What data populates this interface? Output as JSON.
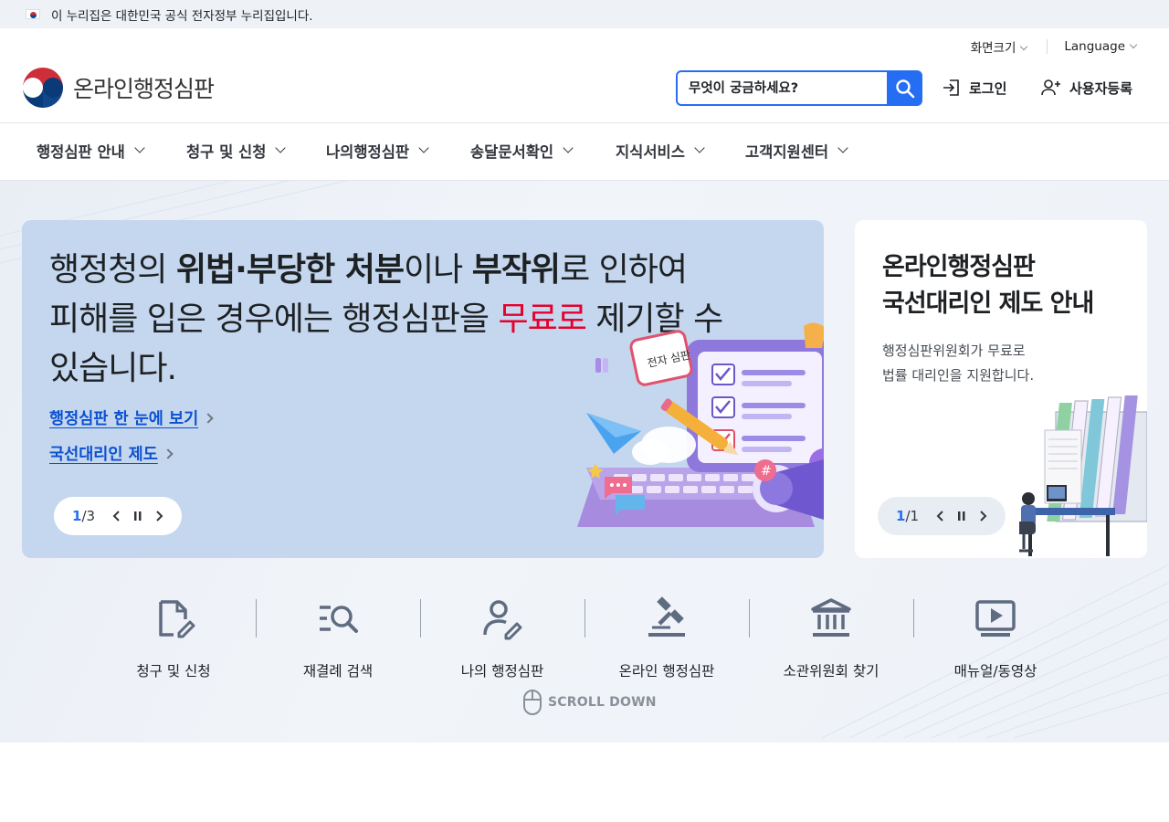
{
  "gov_banner": {
    "text": "이 누리집은 대한민국 공식 전자정부 누리집입니다."
  },
  "utility": {
    "font_size": "화면크기",
    "language": "Language"
  },
  "logo": {
    "text": "온라인행정심판"
  },
  "search": {
    "placeholder": "무엇이 궁금하세요?"
  },
  "header_buttons": {
    "login": "로그인",
    "register": "사용자등록"
  },
  "nav": [
    {
      "label": "행정심판 안내"
    },
    {
      "label": "청구 및 신청"
    },
    {
      "label": "나의행정심판"
    },
    {
      "label": "송달문서확인"
    },
    {
      "label": "지식서비스"
    },
    {
      "label": "고객지원센터"
    }
  ],
  "main_banner": {
    "line1_a": "행정청의 ",
    "line1_b": "위법·부당한 처분",
    "line1_c": "이나 ",
    "line1_d": "부작위",
    "line1_e": "로 인하여",
    "line2_a": "피해를 입은 경우에는 행정심판을 ",
    "line2_red": "무료로",
    "line2_b": " 제기할 수",
    "line3": "있습니다.",
    "link1": "행정심판 한 눈에 보기",
    "link2": "국선대리인 제도",
    "pager_current": "1",
    "pager_total": "/3",
    "illustration_label": "전자 심판"
  },
  "side_banner": {
    "title_line1": "온라인행정심판",
    "title_line2": "국선대리인 제도 안내",
    "desc_line1": "행정심판위원회가 무료로",
    "desc_line2": "법률 대리인을 지원합니다.",
    "pager_current": "1",
    "pager_total": "/1"
  },
  "quick_links": [
    {
      "label": "청구 및 신청",
      "icon": "document-edit-icon"
    },
    {
      "label": "재결례 검색",
      "icon": "list-search-icon"
    },
    {
      "label": "나의 행정심판",
      "icon": "user-edit-icon"
    },
    {
      "label": "온라인 행정심판",
      "icon": "gavel-icon"
    },
    {
      "label": "소관위원회 찾기",
      "icon": "institution-icon"
    },
    {
      "label": "매뉴얼/동영상",
      "icon": "video-play-icon"
    }
  ],
  "scroll_down": "SCROLL DOWN",
  "colors": {
    "primary": "#256ef4",
    "accent_red": "#e6002d",
    "banner_bg": "#c5d7ee",
    "icon": "#5f6b80"
  }
}
